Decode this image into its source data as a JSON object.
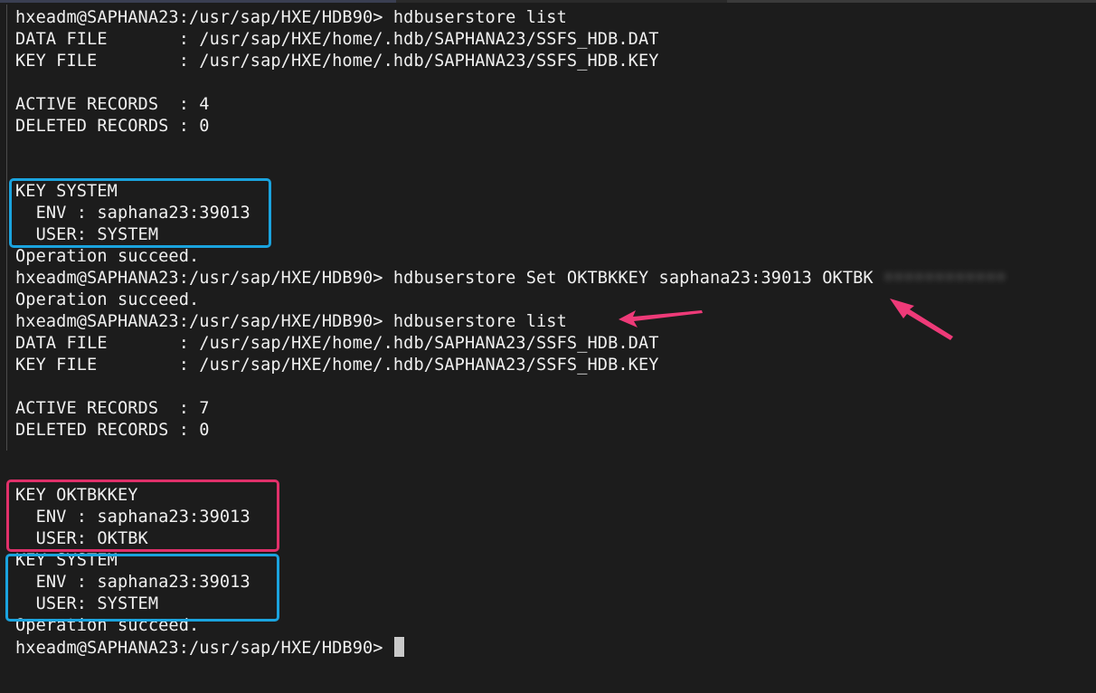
{
  "terminal": {
    "lines": [
      "hxeadm@SAPHANA23:/usr/sap/HXE/HDB90> hdbuserstore list",
      "DATA FILE       : /usr/sap/HXE/home/.hdb/SAPHANA23/SSFS_HDB.DAT",
      "KEY FILE        : /usr/sap/HXE/home/.hdb/SAPHANA23/SSFS_HDB.KEY",
      "",
      "ACTIVE RECORDS  : 4",
      "DELETED RECORDS : 0",
      "",
      "",
      "KEY SYSTEM",
      "  ENV : saphana23:39013",
      "  USER: SYSTEM",
      "Operation succeed.",
      "hxeadm@SAPHANA23:/usr/sap/HXE/HDB90> hdbuserstore Set OKTBKKEY saphana23:39013 OKTBK ",
      "Operation succeed.",
      "hxeadm@SAPHANA23:/usr/sap/HXE/HDB90> hdbuserstore list",
      "DATA FILE       : /usr/sap/HXE/home/.hdb/SAPHANA23/SSFS_HDB.DAT",
      "KEY FILE        : /usr/sap/HXE/home/.hdb/SAPHANA23/SSFS_HDB.KEY",
      "",
      "ACTIVE RECORDS  : 7",
      "DELETED RECORDS : 0",
      "",
      "",
      "KEY OKTBKKEY",
      "  ENV : saphana23:39013",
      "  USER: OKTBK",
      "KEY SYSTEM",
      "  ENV : saphana23:39013",
      "  USER: SYSTEM",
      "Operation succeed.",
      "hxeadm@SAPHANA23:/usr/sap/HXE/HDB90> "
    ],
    "obscured_password": "••••••••••••"
  },
  "colors": {
    "background": "#1c1c1c",
    "text": "#f0f0f0",
    "box_system": "#1aa3de",
    "box_oktbk": "#e0306a",
    "arrow": "#ee3a78"
  },
  "annotations": {
    "boxes": [
      "system-key-box-1",
      "oktbkkey-box",
      "system-key-box-2"
    ],
    "arrows": [
      "arrow-to-list-command",
      "arrow-to-user-argument"
    ]
  }
}
